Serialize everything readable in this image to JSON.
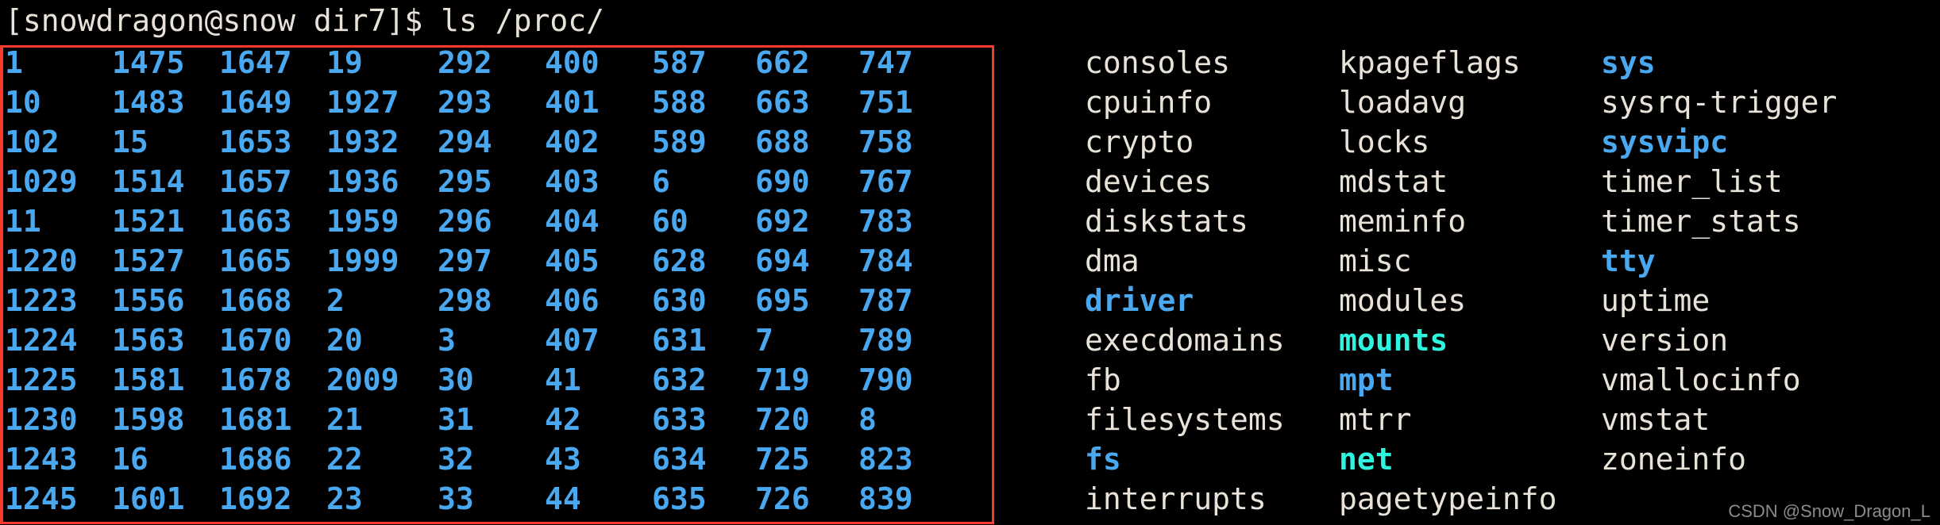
{
  "terminal": {
    "prompt": "[snowdragon@snow dir7]$ ls /proc/",
    "command": "ls /proc/",
    "user_host": "[snowdragon@snow dir7]$",
    "colors": {
      "background": "#000000",
      "foreground": "#e8e2d8",
      "directory": "#4aa8f0",
      "symlink": "#2ef5e0",
      "annotation": "#f93b2c",
      "watermark": "#8b8b8b"
    }
  },
  "annotation": {
    "name": "red-highlight-box",
    "color": "#f93b2c"
  },
  "watermark": {
    "text": "CSDN @Snow_Dragon_L"
  },
  "listing": {
    "columns": [
      {
        "index": 0,
        "type": "numeric",
        "entries": [
          {
            "name": "1",
            "kind": "dir"
          },
          {
            "name": "10",
            "kind": "dir"
          },
          {
            "name": "102",
            "kind": "dir"
          },
          {
            "name": "1029",
            "kind": "dir"
          },
          {
            "name": "11",
            "kind": "dir"
          },
          {
            "name": "1220",
            "kind": "dir"
          },
          {
            "name": "1223",
            "kind": "dir"
          },
          {
            "name": "1224",
            "kind": "dir"
          },
          {
            "name": "1225",
            "kind": "dir"
          },
          {
            "name": "1230",
            "kind": "dir"
          },
          {
            "name": "1243",
            "kind": "dir"
          },
          {
            "name": "1245",
            "kind": "dir"
          }
        ]
      },
      {
        "index": 1,
        "type": "numeric",
        "entries": [
          {
            "name": "1475",
            "kind": "dir"
          },
          {
            "name": "1483",
            "kind": "dir"
          },
          {
            "name": "15",
            "kind": "dir"
          },
          {
            "name": "1514",
            "kind": "dir"
          },
          {
            "name": "1521",
            "kind": "dir"
          },
          {
            "name": "1527",
            "kind": "dir"
          },
          {
            "name": "1556",
            "kind": "dir"
          },
          {
            "name": "1563",
            "kind": "dir"
          },
          {
            "name": "1581",
            "kind": "dir"
          },
          {
            "name": "1598",
            "kind": "dir"
          },
          {
            "name": "16",
            "kind": "dir"
          },
          {
            "name": "1601",
            "kind": "dir"
          }
        ]
      },
      {
        "index": 2,
        "type": "numeric",
        "entries": [
          {
            "name": "1647",
            "kind": "dir"
          },
          {
            "name": "1649",
            "kind": "dir"
          },
          {
            "name": "1653",
            "kind": "dir"
          },
          {
            "name": "1657",
            "kind": "dir"
          },
          {
            "name": "1663",
            "kind": "dir"
          },
          {
            "name": "1665",
            "kind": "dir"
          },
          {
            "name": "1668",
            "kind": "dir"
          },
          {
            "name": "1670",
            "kind": "dir"
          },
          {
            "name": "1678",
            "kind": "dir"
          },
          {
            "name": "1681",
            "kind": "dir"
          },
          {
            "name": "1686",
            "kind": "dir"
          },
          {
            "name": "1692",
            "kind": "dir"
          }
        ]
      },
      {
        "index": 3,
        "type": "numeric",
        "entries": [
          {
            "name": "19",
            "kind": "dir"
          },
          {
            "name": "1927",
            "kind": "dir"
          },
          {
            "name": "1932",
            "kind": "dir"
          },
          {
            "name": "1936",
            "kind": "dir"
          },
          {
            "name": "1959",
            "kind": "dir"
          },
          {
            "name": "1999",
            "kind": "dir"
          },
          {
            "name": "2",
            "kind": "dir"
          },
          {
            "name": "20",
            "kind": "dir"
          },
          {
            "name": "2009",
            "kind": "dir"
          },
          {
            "name": "21",
            "kind": "dir"
          },
          {
            "name": "22",
            "kind": "dir"
          },
          {
            "name": "23",
            "kind": "dir"
          }
        ]
      },
      {
        "index": 4,
        "type": "numeric",
        "entries": [
          {
            "name": "292",
            "kind": "dir"
          },
          {
            "name": "293",
            "kind": "dir"
          },
          {
            "name": "294",
            "kind": "dir"
          },
          {
            "name": "295",
            "kind": "dir"
          },
          {
            "name": "296",
            "kind": "dir"
          },
          {
            "name": "297",
            "kind": "dir"
          },
          {
            "name": "298",
            "kind": "dir"
          },
          {
            "name": "3",
            "kind": "dir"
          },
          {
            "name": "30",
            "kind": "dir"
          },
          {
            "name": "31",
            "kind": "dir"
          },
          {
            "name": "32",
            "kind": "dir"
          },
          {
            "name": "33",
            "kind": "dir"
          }
        ]
      },
      {
        "index": 5,
        "type": "numeric",
        "entries": [
          {
            "name": "400",
            "kind": "dir"
          },
          {
            "name": "401",
            "kind": "dir"
          },
          {
            "name": "402",
            "kind": "dir"
          },
          {
            "name": "403",
            "kind": "dir"
          },
          {
            "name": "404",
            "kind": "dir"
          },
          {
            "name": "405",
            "kind": "dir"
          },
          {
            "name": "406",
            "kind": "dir"
          },
          {
            "name": "407",
            "kind": "dir"
          },
          {
            "name": "41",
            "kind": "dir"
          },
          {
            "name": "42",
            "kind": "dir"
          },
          {
            "name": "43",
            "kind": "dir"
          },
          {
            "name": "44",
            "kind": "dir"
          }
        ]
      },
      {
        "index": 6,
        "type": "numeric",
        "entries": [
          {
            "name": "587",
            "kind": "dir"
          },
          {
            "name": "588",
            "kind": "dir"
          },
          {
            "name": "589",
            "kind": "dir"
          },
          {
            "name": "6",
            "kind": "dir"
          },
          {
            "name": "60",
            "kind": "dir"
          },
          {
            "name": "628",
            "kind": "dir"
          },
          {
            "name": "630",
            "kind": "dir"
          },
          {
            "name": "631",
            "kind": "dir"
          },
          {
            "name": "632",
            "kind": "dir"
          },
          {
            "name": "633",
            "kind": "dir"
          },
          {
            "name": "634",
            "kind": "dir"
          },
          {
            "name": "635",
            "kind": "dir"
          }
        ]
      },
      {
        "index": 7,
        "type": "numeric",
        "entries": [
          {
            "name": "662",
            "kind": "dir"
          },
          {
            "name": "663",
            "kind": "dir"
          },
          {
            "name": "688",
            "kind": "dir"
          },
          {
            "name": "690",
            "kind": "dir"
          },
          {
            "name": "692",
            "kind": "dir"
          },
          {
            "name": "694",
            "kind": "dir"
          },
          {
            "name": "695",
            "kind": "dir"
          },
          {
            "name": "7",
            "kind": "dir"
          },
          {
            "name": "719",
            "kind": "dir"
          },
          {
            "name": "720",
            "kind": "dir"
          },
          {
            "name": "725",
            "kind": "dir"
          },
          {
            "name": "726",
            "kind": "dir"
          }
        ]
      },
      {
        "index": 8,
        "type": "numeric",
        "entries": [
          {
            "name": "747",
            "kind": "dir"
          },
          {
            "name": "751",
            "kind": "dir"
          },
          {
            "name": "758",
            "kind": "dir"
          },
          {
            "name": "767",
            "kind": "dir"
          },
          {
            "name": "783",
            "kind": "dir"
          },
          {
            "name": "784",
            "kind": "dir"
          },
          {
            "name": "787",
            "kind": "dir"
          },
          {
            "name": "789",
            "kind": "dir"
          },
          {
            "name": "790",
            "kind": "dir"
          },
          {
            "name": "8",
            "kind": "dir"
          },
          {
            "name": "823",
            "kind": "dir"
          },
          {
            "name": "839",
            "kind": "dir"
          }
        ]
      },
      {
        "index": 9,
        "type": "name",
        "entries": [
          {
            "name": "consoles",
            "kind": "file"
          },
          {
            "name": "cpuinfo",
            "kind": "file"
          },
          {
            "name": "crypto",
            "kind": "file"
          },
          {
            "name": "devices",
            "kind": "file"
          },
          {
            "name": "diskstats",
            "kind": "file"
          },
          {
            "name": "dma",
            "kind": "file"
          },
          {
            "name": "driver",
            "kind": "dir"
          },
          {
            "name": "execdomains",
            "kind": "file"
          },
          {
            "name": "fb",
            "kind": "file"
          },
          {
            "name": "filesystems",
            "kind": "file"
          },
          {
            "name": "fs",
            "kind": "dir"
          },
          {
            "name": "interrupts",
            "kind": "file"
          }
        ]
      },
      {
        "index": 10,
        "type": "name",
        "entries": [
          {
            "name": "kpageflags",
            "kind": "file"
          },
          {
            "name": "loadavg",
            "kind": "file"
          },
          {
            "name": "locks",
            "kind": "file"
          },
          {
            "name": "mdstat",
            "kind": "file"
          },
          {
            "name": "meminfo",
            "kind": "file"
          },
          {
            "name": "misc",
            "kind": "file"
          },
          {
            "name": "modules",
            "kind": "file"
          },
          {
            "name": "mounts",
            "kind": "link"
          },
          {
            "name": "mpt",
            "kind": "dir"
          },
          {
            "name": "mtrr",
            "kind": "file"
          },
          {
            "name": "net",
            "kind": "link"
          },
          {
            "name": "pagetypeinfo",
            "kind": "file"
          }
        ]
      },
      {
        "index": 11,
        "type": "name",
        "entries": [
          {
            "name": "sys",
            "kind": "dir"
          },
          {
            "name": "sysrq-trigger",
            "kind": "file"
          },
          {
            "name": "sysvipc",
            "kind": "dir"
          },
          {
            "name": "timer_list",
            "kind": "file"
          },
          {
            "name": "timer_stats",
            "kind": "file"
          },
          {
            "name": "tty",
            "kind": "dir"
          },
          {
            "name": "uptime",
            "kind": "file"
          },
          {
            "name": "version",
            "kind": "file"
          },
          {
            "name": "vmallocinfo",
            "kind": "file"
          },
          {
            "name": "vmstat",
            "kind": "file"
          },
          {
            "name": "zoneinfo",
            "kind": "file"
          },
          {
            "name": "",
            "kind": "file"
          }
        ]
      }
    ]
  }
}
